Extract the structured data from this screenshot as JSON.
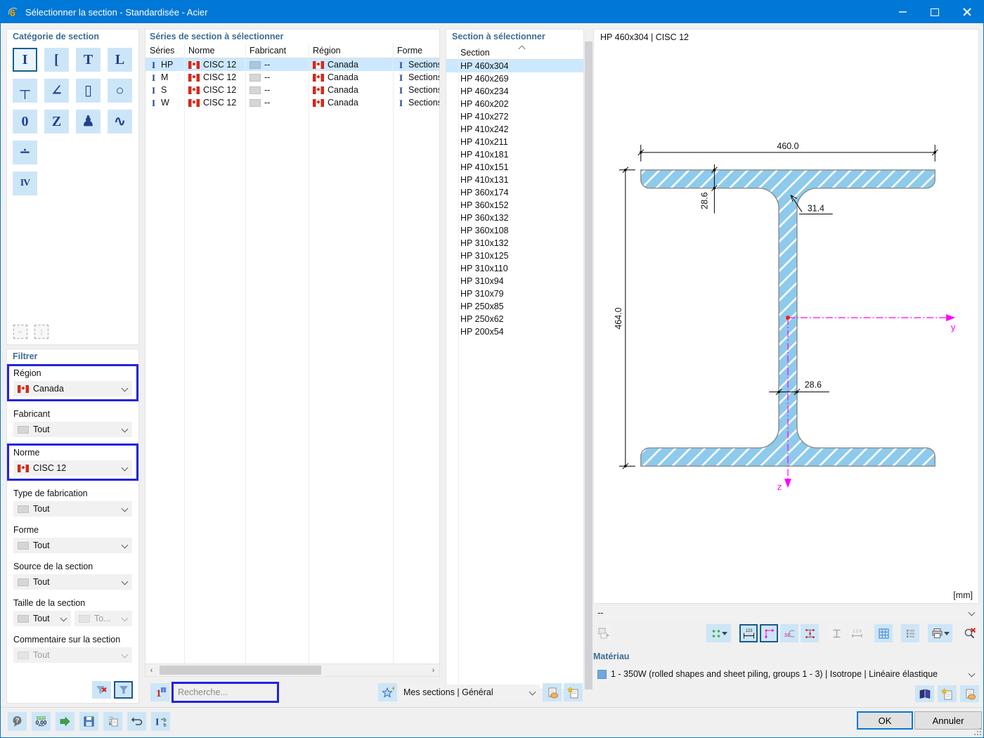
{
  "window": {
    "title": "Sélectionner la section - Standardisée - Acier"
  },
  "category": {
    "title": "Catégorie de section",
    "items": [
      {
        "glyph": "I",
        "name": "i-section",
        "cls": "sel"
      },
      {
        "glyph": "[",
        "name": "c-section",
        "cls": ""
      },
      {
        "glyph": "T",
        "name": "t-section",
        "cls": ""
      },
      {
        "glyph": "L",
        "name": "l-section",
        "cls": ""
      },
      {
        "glyph": "┬",
        "name": "hat-section",
        "cls": ""
      },
      {
        "glyph": "∠",
        "name": "angle-section",
        "cls": ""
      },
      {
        "glyph": "▯",
        "name": "hollow-rect-section",
        "cls": ""
      },
      {
        "glyph": "○",
        "name": "hollow-round-section",
        "cls": ""
      },
      {
        "glyph": "0",
        "name": "pipe-section",
        "cls": ""
      },
      {
        "glyph": "Z",
        "name": "z-section",
        "cls": ""
      },
      {
        "glyph": "♟",
        "name": "rail-section",
        "cls": ""
      },
      {
        "glyph": "∿",
        "name": "corrugated-section",
        "cls": ""
      },
      {
        "glyph": "∸",
        "name": "point-section",
        "cls": "nl"
      },
      {
        "glyph": "IV",
        "name": "combined-section",
        "cls": "nl sm"
      }
    ]
  },
  "filter": {
    "title": "Filtrer",
    "items": [
      {
        "label": "Région",
        "value": "Canada",
        "icon": "flag",
        "cls": "hl"
      },
      {
        "label": "Fabricant",
        "value": "Tout",
        "icon": "swatch",
        "cls": ""
      },
      {
        "label": "Norme",
        "value": "CISC 12",
        "icon": "flag",
        "cls": "hl"
      },
      {
        "label": "Type de fabrication",
        "value": "Tout",
        "icon": "swatch",
        "cls": ""
      },
      {
        "label": "Forme",
        "value": "Tout",
        "icon": "swatch",
        "cls": ""
      },
      {
        "label": "Source de la section",
        "value": "Tout",
        "icon": "swatch",
        "cls": ""
      },
      {
        "label": "Taille de la section",
        "value": "Tout",
        "value2": "To...",
        "icon": "swatch",
        "cls": "dual"
      },
      {
        "label": "Commentaire sur la section",
        "value": "Tout",
        "icon": "swatch",
        "cls": "off"
      }
    ]
  },
  "series": {
    "title": "Séries de section à sélectionner",
    "columns": [
      "Séries",
      "Norme",
      "Fabricant",
      "Région",
      "Forme"
    ],
    "rows": [
      {
        "series": "HP",
        "norme": "CISC 12",
        "fabricant": "--",
        "region": "Canada",
        "forme": "Sections",
        "cls": "selected",
        "sw": "sw-blue"
      },
      {
        "series": "M",
        "norme": "CISC 12",
        "fabricant": "--",
        "region": "Canada",
        "forme": "Sections",
        "cls": "",
        "sw": "sw-gray"
      },
      {
        "series": "S",
        "norme": "CISC 12",
        "fabricant": "--",
        "region": "Canada",
        "forme": "Sections",
        "cls": "",
        "sw": "sw-gray"
      },
      {
        "series": "W",
        "norme": "CISC 12",
        "fabricant": "--",
        "region": "Canada",
        "forme": "Sections",
        "cls": "",
        "sw": "sw-gray"
      }
    ]
  },
  "sections": {
    "title": "Section à sélectionner",
    "column": "Section",
    "items": [
      {
        "label": "HP 460x304",
        "cls": "selected"
      },
      {
        "label": "HP 460x269",
        "cls": ""
      },
      {
        "label": "HP 460x234",
        "cls": ""
      },
      {
        "label": "HP 460x202",
        "cls": ""
      },
      {
        "label": "HP 410x272",
        "cls": ""
      },
      {
        "label": "HP 410x242",
        "cls": ""
      },
      {
        "label": "HP 410x211",
        "cls": ""
      },
      {
        "label": "HP 410x181",
        "cls": ""
      },
      {
        "label": "HP 410x151",
        "cls": ""
      },
      {
        "label": "HP 410x131",
        "cls": ""
      },
      {
        "label": "HP 360x174",
        "cls": ""
      },
      {
        "label": "HP 360x152",
        "cls": ""
      },
      {
        "label": "HP 360x132",
        "cls": ""
      },
      {
        "label": "HP 360x108",
        "cls": ""
      },
      {
        "label": "HP 310x132",
        "cls": ""
      },
      {
        "label": "HP 310x125",
        "cls": ""
      },
      {
        "label": "HP 310x110",
        "cls": ""
      },
      {
        "label": "HP 310x94",
        "cls": ""
      },
      {
        "label": "HP 310x79",
        "cls": ""
      },
      {
        "label": "HP 250x85",
        "cls": ""
      },
      {
        "label": "HP 250x62",
        "cls": ""
      },
      {
        "label": "HP 200x54",
        "cls": ""
      }
    ]
  },
  "preview": {
    "header": "HP 460x304 | CISC 12",
    "unit": "[mm]",
    "combo": "--",
    "dims": {
      "width": "460.0",
      "flange": "28.6",
      "fillet": "31.4",
      "height": "464.0",
      "web": "28.6"
    },
    "axis_y": "y",
    "axis_z": "z"
  },
  "material": {
    "title": "Matériau",
    "value": "1 - 350W (rolled shapes and sheet piling, groups 1 - 3) | Isotrope | Linéaire élastique"
  },
  "search": {
    "placeholder": "Recherche..."
  },
  "favorites": {
    "value": "Mes sections | Général"
  },
  "buttons": {
    "ok": "OK",
    "cancel": "Annuler"
  },
  "icons": {
    "app": "6",
    "ibeam": "I",
    "dim_label": "123",
    "numbering_label": "1 2 3",
    "sc": "sc",
    "decimal": "0,00",
    "bh_b": "b",
    "bh_h": "h"
  },
  "colors": {
    "titlebar": "#0078D7",
    "selection": "#CCE8FF",
    "highlight_border": "#2323DF",
    "beam_fill": "#8DCAEC",
    "axis_magenta": "#FF00FF",
    "accent_buttons": "#CDE6F7"
  }
}
